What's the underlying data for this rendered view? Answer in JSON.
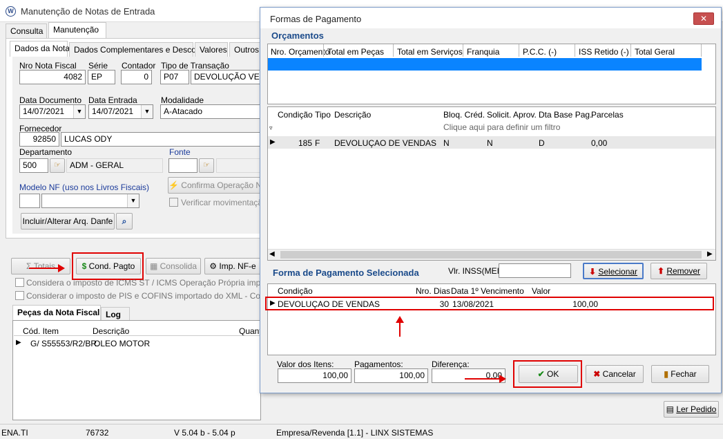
{
  "main_window": {
    "title": "Manutenção de Notas de Entrada",
    "top_tabs": [
      "Consulta",
      "Manutenção"
    ],
    "sub_tabs": [
      "Dados da Nota",
      "Dados Complementares e Desconto",
      "Valores",
      "Outros V"
    ],
    "labels": {
      "nro_nota": "Nro Nota Fiscal",
      "serie": "Série",
      "contador": "Contador",
      "tipo_transacao": "Tipo de Transação",
      "data_documento": "Data Documento",
      "data_entrada": "Data Entrada",
      "modalidade": "Modalidade",
      "fornecedor": "Fornecedor",
      "departamento": "Departamento",
      "fonte": "Fonte",
      "modelo_nf": "Modelo NF (uso nos Livros Fiscais)"
    },
    "values": {
      "nro_nota": "4082",
      "serie": "EP",
      "contador": "0",
      "tipo_transacao_code": "P07",
      "tipo_transacao_desc": "DEVOLUÇÃO VENDA",
      "data_documento": "14/07/2021",
      "data_entrada": "14/07/2021",
      "modalidade": "A-Atacado",
      "fornecedor_code": "92850",
      "fornecedor_name": "LUCAS ODY",
      "departamento_code": "500",
      "departamento_name": "ADM - GERAL",
      "fonte_code": "",
      "modelo_nf_code": "",
      "modelo_nf_desc": ""
    },
    "buttons": {
      "confirma": "Confirma Operação N",
      "verificar": "Verificar movimentação",
      "danfe": "Incluir/Alterar Arq. Danfe",
      "totais": "Totais",
      "cond_pagto": "Cond. Pagto",
      "consolida": "Consolida",
      "imp_nfe": "Imp. NF-e"
    },
    "checkboxes": {
      "icms": "Considera o imposto de ICMS ST / ICMS Operação Própria importado do",
      "pis": "Considerar o imposto de PIS e COFINS importado do XML - Conforme p"
    },
    "bottom_tabs": [
      "Peças da Nota Fiscal",
      "Log"
    ],
    "items_grid": {
      "headers": [
        "Cód. Item",
        "Descrição",
        "Quant"
      ],
      "rows": [
        {
          "cod": "G/  S55553/R2/BR.",
          "desc": "OLEO MOTOR"
        }
      ]
    },
    "ler_pedido": "Ler Pedido"
  },
  "dialog": {
    "title": "Formas de Pagamento",
    "close": "✕",
    "orcamentos": {
      "heading": "Orçamentos",
      "headers": [
        "Nro. Orçamento",
        "Total em Peças",
        "Total em Serviços",
        "Franquia",
        "P.C.C. (-)",
        "ISS Retido (-)",
        "Total Geral"
      ]
    },
    "condicoes": {
      "headers": [
        "Condição",
        "Tipo",
        "Descrição",
        "Bloq. Créd.",
        "Solicit. Aprov.",
        "Dta Base Pag.",
        "Parcelas"
      ],
      "filter_hint": "Clique aqui para definir um filtro",
      "row": {
        "condicao": "185",
        "tipo": "F",
        "descricao": "DEVOLUÇAO DE VENDAS",
        "bloq": "N",
        "solicit": "N",
        "dta_base": "D",
        "parcelas": "0,00"
      }
    },
    "forma_selecionada": {
      "heading": "Forma de Pagamento Selecionada",
      "vlr_inss_label": "Vlr. INSS(MEI):",
      "vlr_inss_value": "",
      "selecionar": "Selecionar",
      "remover": "Remover",
      "headers": [
        "Condição",
        "Nro. Dias",
        "Data 1º Vencimento",
        "Valor"
      ],
      "row": {
        "condicao": "DEVOLUÇAO DE VENDAS",
        "dias": "30",
        "vencimento": "13/08/2021",
        "valor": "100,00"
      }
    },
    "totais": {
      "valor_itens_label": "Valor dos Itens:",
      "valor_itens": "100,00",
      "pagamentos_label": "Pagamentos:",
      "pagamentos": "100,00",
      "diferenca_label": "Diferença:",
      "diferenca": "0,00"
    },
    "buttons": {
      "ok": "OK",
      "cancelar": "Cancelar",
      "fechar": "Fechar"
    }
  },
  "status_bar": [
    "ENA.TI",
    "76732",
    "V 5.04 b   -   5.04 p",
    "Empresa/Revenda [1.1] - LINX SISTEMAS"
  ],
  "colors": {
    "highlight_red": "#e00000",
    "selected_row": "#0a84ff",
    "section_blue": "#1a4a8a"
  }
}
